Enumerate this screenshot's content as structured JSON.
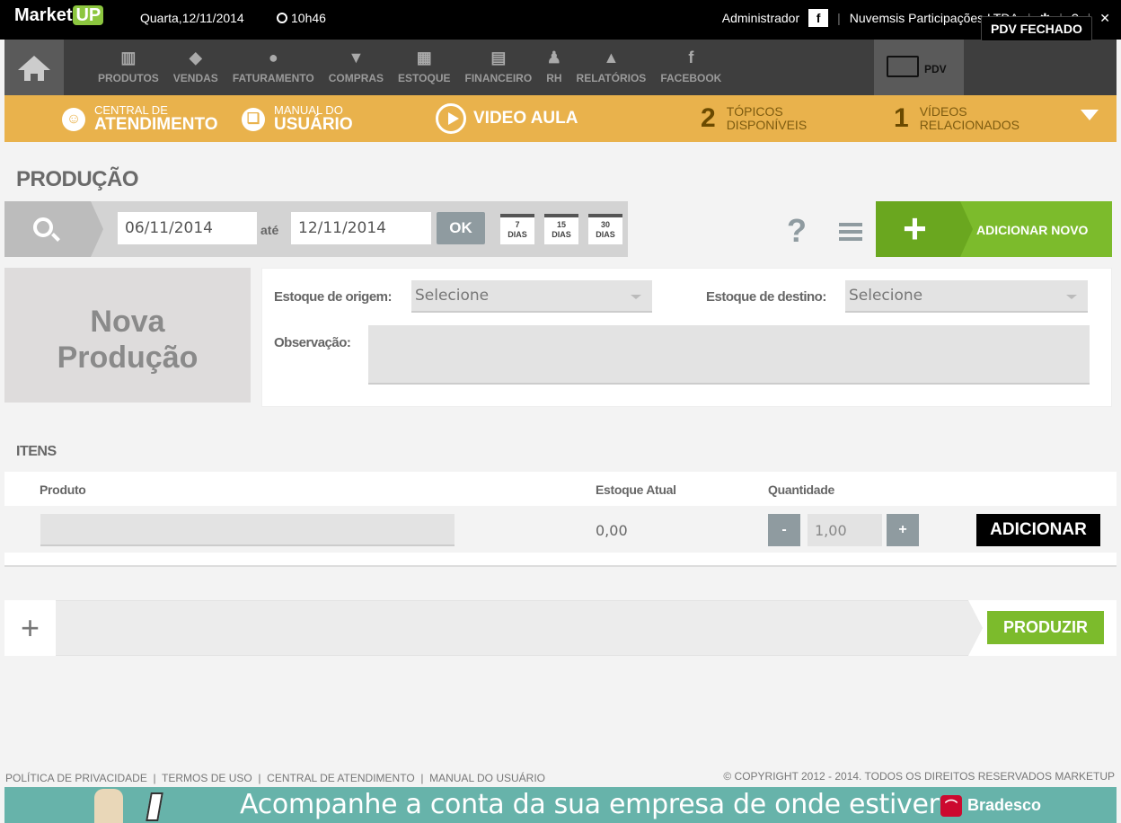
{
  "topbar": {
    "logo_market": "Market",
    "logo_up": "UP",
    "date": "Quarta,12/11/2014",
    "time": "10h46",
    "user": "Administrador",
    "facebook": "f",
    "company": "Nuvemsis Participações LTDA",
    "help": "?",
    "close": "✕"
  },
  "nav": {
    "items": [
      {
        "label": "PRODUTOS",
        "icon": "barcode-icon",
        "glyph": "▥"
      },
      {
        "label": "VENDAS",
        "icon": "tag-icon",
        "glyph": "◆"
      },
      {
        "label": "FATURAMENTO",
        "icon": "money-bag-icon",
        "glyph": "●"
      },
      {
        "label": "COMPRAS",
        "icon": "basket-icon",
        "glyph": "▼"
      },
      {
        "label": "ESTOQUE",
        "icon": "cart-icon",
        "glyph": "▦"
      },
      {
        "label": "FINANCEIRO",
        "icon": "calculator-icon",
        "glyph": "▤"
      },
      {
        "label": "RH",
        "icon": "person-icon",
        "glyph": "♟"
      },
      {
        "label": "RELATÓRIOS",
        "icon": "chart-icon",
        "glyph": "▲"
      },
      {
        "label": "FACEBOOK",
        "icon": "facebook-icon",
        "glyph": "f"
      }
    ],
    "pdv": "PDV",
    "pdv_status": "PDV FECHADO"
  },
  "help_strip": {
    "central_small": "CENTRAL DE",
    "central_big": "ATENDIMENTO",
    "manual_small": "MANUAL DO",
    "manual_big": "USUÁRIO",
    "video": "VIDEO AULA",
    "topics_count": "2",
    "topics_line1": "TÓPICOS",
    "topics_line2": "DISPONÍVEIS",
    "videos_count": "1",
    "videos_line1": "VÍDEOS",
    "videos_line2": "RELACIONADOS"
  },
  "page": {
    "title": "PRODUÇÃO"
  },
  "filter": {
    "date_from": "06/11/2014",
    "until": "até",
    "date_to": "12/11/2014",
    "ok": "OK",
    "presets": [
      {
        "n": "7",
        "unit": "DIAS"
      },
      {
        "n": "15",
        "unit": "DIAS"
      },
      {
        "n": "30",
        "unit": "DIAS"
      }
    ],
    "help": "?",
    "add_plus": "+",
    "add_new": "ADICIONAR NOVO"
  },
  "form": {
    "nova_line1": "Nova",
    "nova_line2": "Produção",
    "origin_label": "Estoque de origem:",
    "origin_value": "Selecione",
    "dest_label": "Estoque de destino:",
    "dest_value": "Selecione",
    "obs_label": "Observação:"
  },
  "itens": {
    "title": "ITENS",
    "col_product": "Produto",
    "col_stock": "Estoque Atual",
    "col_qty": "Quantidade",
    "row": {
      "stock": "0,00",
      "minus": "-",
      "qty": "1,00",
      "plus": "+",
      "add": "ADICIONAR"
    }
  },
  "actions": {
    "plus": "+",
    "produce": "PRODUZIR"
  },
  "footer": {
    "links": "POLÍTICA DE PRIVACIDADE  |  TERMOS DE USO  |  CENTRAL DE ATENDIMENTO  |  MANUAL DO USUÁRIO",
    "copyright": "© COPYRIGHT 2012 - 2014. TODOS OS DIREITOS RESERVADOS MARKETUP",
    "banner_text": "Acompanhe a conta da sua empresa de onde estiver",
    "bank": "Bradesco"
  },
  "colors": {
    "accent_green": "#7cbb2c",
    "help_yellow": "#e9b24c",
    "banner_teal": "#67b3aa"
  }
}
